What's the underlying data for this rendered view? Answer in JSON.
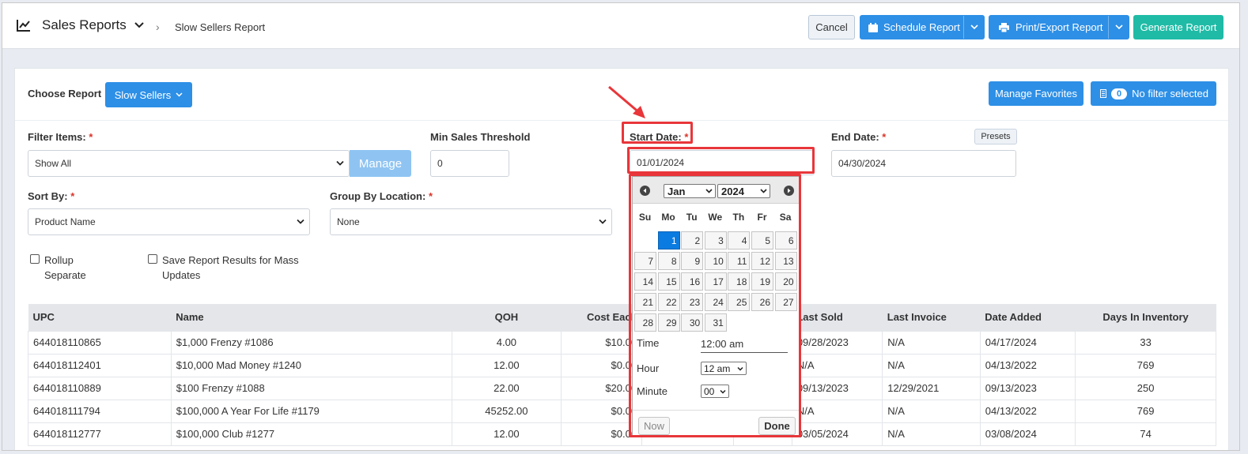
{
  "header": {
    "app_title": "Sales Reports",
    "breadcrumb": "Slow Sellers Report",
    "cancel_label": "Cancel",
    "schedule_label": "Schedule Report",
    "print_label": "Print/Export Report",
    "generate_label": "Generate Report"
  },
  "report": {
    "choose_label": "Choose Report",
    "selected_report": "Slow Sellers",
    "manage_favorites_label": "Manage Favorites",
    "filter_count": "0",
    "filter_status": "No filter selected"
  },
  "filters": {
    "filter_items_label": "Filter Items:",
    "filter_items_value": "Show All",
    "manage_label": "Manage",
    "min_sales_label": "Min Sales Threshold",
    "min_sales_value": "0",
    "start_date_label": "Start Date:",
    "start_date_value": "01/01/2024",
    "end_date_label": "End Date:",
    "end_date_value": "04/30/2024",
    "presets_label": "Presets",
    "sort_by_label": "Sort By:",
    "sort_by_value": "Product Name",
    "group_by_label": "Group By Location:",
    "group_by_value": "None",
    "required_mark": "*",
    "rollup_label_1": "Rollup",
    "rollup_label_2": "Separate",
    "save_results_label_1": "Save Report Results for Mass",
    "save_results_label_2": "Updates"
  },
  "table": {
    "headers": [
      "UPC",
      "Name",
      "QOH",
      "Cost Each",
      "",
      "Last Sold",
      "Last Invoice",
      "Date Added",
      "Days In Inventory"
    ],
    "rows": [
      [
        "644018110865",
        "$1,000 Frenzy #1086",
        "4.00",
        "$10.00",
        "",
        "09/28/2023",
        "N/A",
        "04/17/2024",
        "33"
      ],
      [
        "644018112401",
        "$10,000 Mad Money #1240",
        "12.00",
        "$0.00",
        "",
        "N/A",
        "N/A",
        "04/13/2022",
        "769"
      ],
      [
        "644018110889",
        "$100 Frenzy #1088",
        "22.00",
        "$20.00",
        "",
        "09/13/2023",
        "12/29/2021",
        "09/13/2023",
        "250"
      ],
      [
        "644018111794",
        "$100,000 A Year For Life #1179",
        "45252.00",
        "$0.00",
        "",
        "N/A",
        "N/A",
        "04/13/2022",
        "769"
      ],
      [
        "644018112777",
        "$100,000 Club #1277",
        "12.00",
        "$0.00",
        "",
        "03/05/2024",
        "N/A",
        "03/08/2024",
        "74"
      ]
    ]
  },
  "datepicker": {
    "month": "Jan",
    "year": "2024",
    "weekdays": [
      "Su",
      "Mo",
      "Tu",
      "We",
      "Th",
      "Fr",
      "Sa"
    ],
    "first_weekday": 1,
    "days_in_month": 31,
    "selected_day": "1",
    "days": [
      "1",
      "2",
      "3",
      "4",
      "5",
      "6",
      "7",
      "8",
      "9",
      "10",
      "11",
      "12",
      "13",
      "14",
      "15",
      "16",
      "17",
      "18",
      "19",
      "20",
      "21",
      "22",
      "23",
      "24",
      "25",
      "26",
      "27",
      "28",
      "29",
      "30",
      "31"
    ],
    "time_label": "Time",
    "time_value": "12:00 am",
    "hour_label": "Hour",
    "hour_value": "12 am",
    "minute_label": "Minute",
    "minute_value": "00",
    "now_label": "Now",
    "done_label": "Done"
  },
  "colors": {
    "primary": "#2d8fe6",
    "teal": "#1fbba6",
    "annotation": "#e8363a",
    "selected_day": "#0a7be0"
  }
}
